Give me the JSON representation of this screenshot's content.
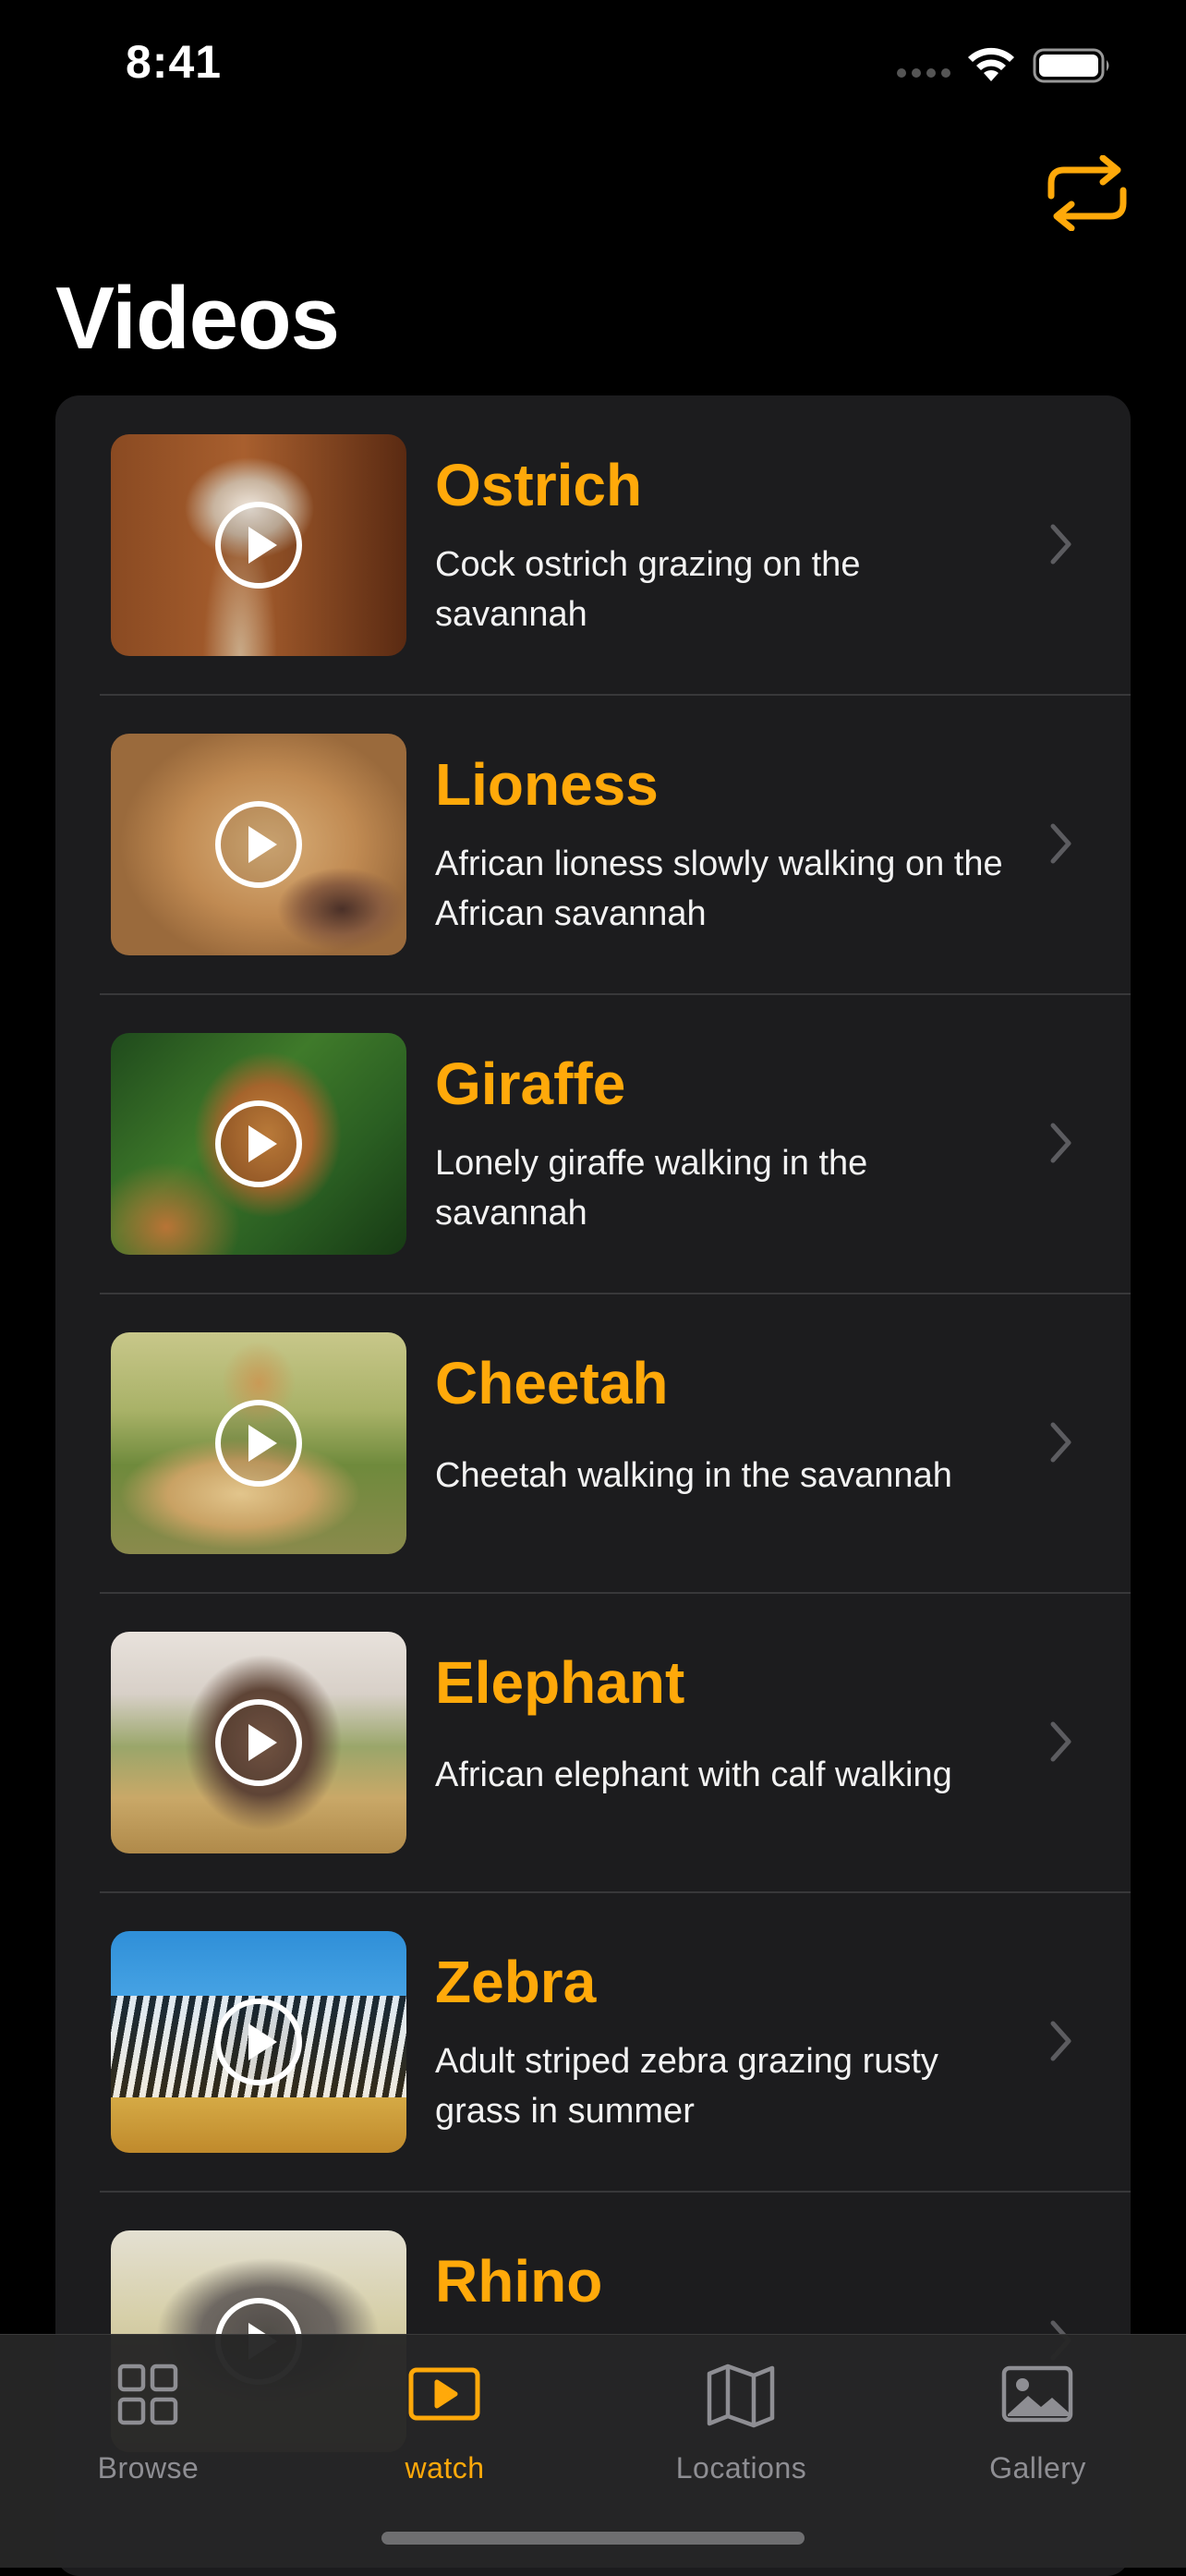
{
  "status_bar": {
    "time": "8:41"
  },
  "header": {
    "title": "Videos",
    "action_icon": "swap-arrows-icon"
  },
  "colors": {
    "accent": "#ffa90a",
    "background": "#000000",
    "card": "#1c1c1e",
    "inactive": "#8e8e93"
  },
  "videos": [
    {
      "name": "Ostrich",
      "description": "Cock ostrich grazing on the savannah"
    },
    {
      "name": "Lioness",
      "description": "African lioness slowly walking on the African savannah"
    },
    {
      "name": "Giraffe",
      "description": "Lonely giraffe walking in the savannah"
    },
    {
      "name": "Cheetah",
      "description": "Cheetah walking in the savannah"
    },
    {
      "name": "Elephant",
      "description": "African elephant with calf walking"
    },
    {
      "name": "Zebra",
      "description": "Adult striped zebra grazing rusty grass in summer"
    },
    {
      "name": "Rhino",
      "description": ""
    }
  ],
  "tab_bar": {
    "selected": "watch",
    "tabs": [
      {
        "label": "Browse",
        "icon": "grid-icon"
      },
      {
        "label": "watch",
        "icon": "play-rectangle-icon"
      },
      {
        "label": "Locations",
        "icon": "map-icon"
      },
      {
        "label": "Gallery",
        "icon": "photo-icon"
      }
    ]
  }
}
